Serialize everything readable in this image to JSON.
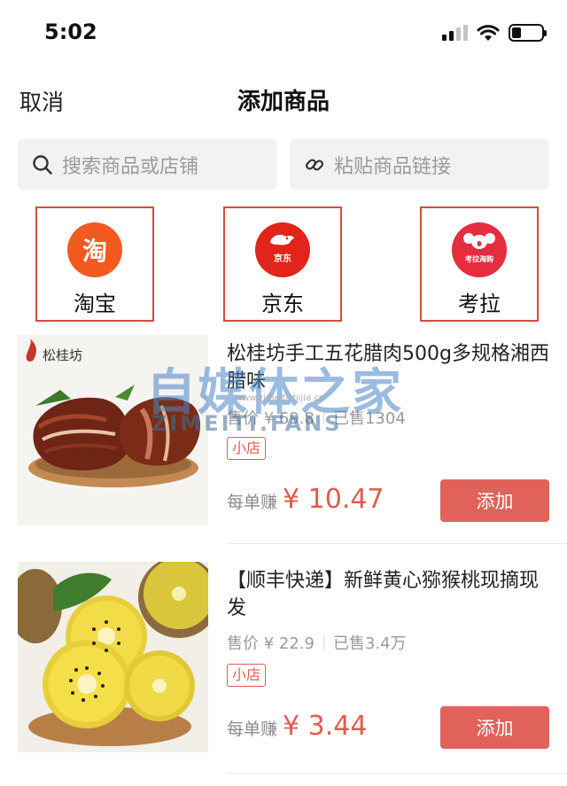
{
  "status_bar": {
    "time": "5:02"
  },
  "header": {
    "cancel_label": "取消",
    "title": "添加商品"
  },
  "search": {
    "product_placeholder": "搜索商品或店铺",
    "link_placeholder": "粘贴商品链接"
  },
  "platforms": [
    {
      "name": "淘宝",
      "logo_text": "淘",
      "color": "#f25a1f"
    },
    {
      "name": "京东",
      "logo_text": "京东",
      "color": "#e1251b"
    },
    {
      "name": "考拉",
      "logo_text": "考拉海购",
      "color": "#e52d3f"
    }
  ],
  "products": [
    {
      "image_brand": "松桂坊",
      "title": "松桂坊手工五花腊肉500g多规格湘西腊味",
      "price_label": "售价 ¥ 69.8",
      "sold_label": "已售1304",
      "badge": "小店",
      "earn_label": "每单赚",
      "earn_amount": "¥ 10.47",
      "add_label": "添加"
    },
    {
      "title": "【顺丰快递】新鲜黄心猕猴桃现摘现发",
      "price_label": "售价 ¥ 22.9",
      "sold_label": "已售3.4万",
      "badge": "小店",
      "earn_label": "每单赚",
      "earn_amount": "¥ 3.44",
      "add_label": "添加"
    }
  ],
  "watermark": {
    "main": "自媒体之家",
    "sub": "ZIMEITI.FANS",
    "url": "www.zimeitizhijia.cn"
  },
  "colors": {
    "accent": "#e0625a",
    "frame_red": "#d94a3f",
    "search_bg": "#f2f2f3"
  }
}
